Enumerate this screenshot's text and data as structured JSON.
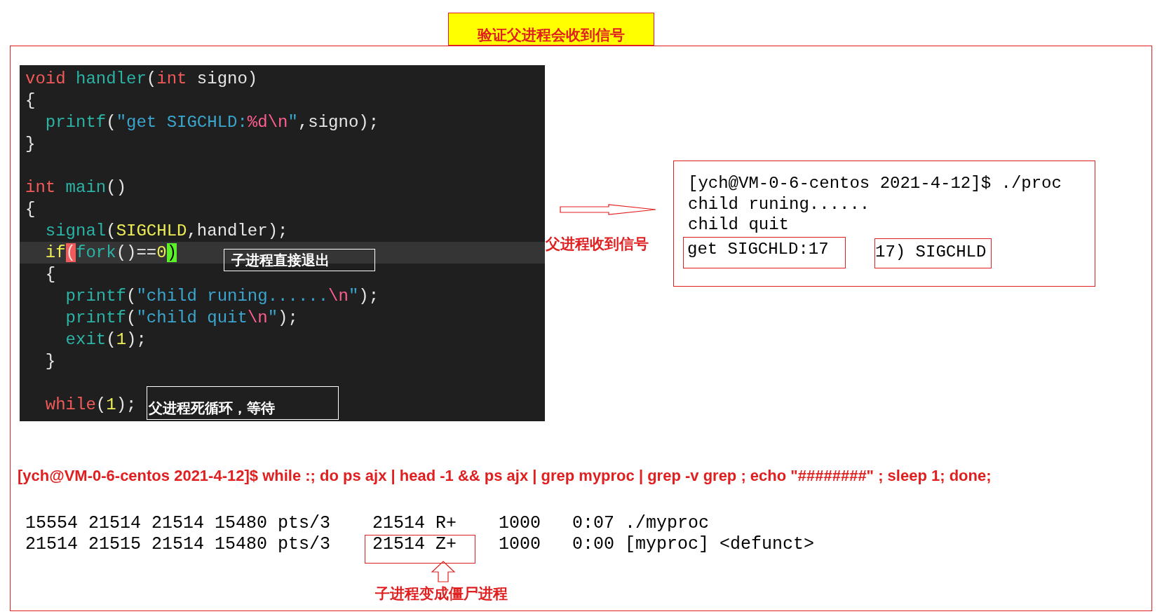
{
  "title": "验证父进程会收到信号",
  "code": {
    "lines": [
      {
        "current": false,
        "tokens": [
          {
            "kind": "kw",
            "text": "void"
          },
          {
            "kind": "fn",
            "text": " handler"
          },
          {
            "kind": "plain",
            "text": "("
          },
          {
            "kind": "kw",
            "text": "int"
          },
          {
            "kind": "plain",
            "text": " signo)"
          }
        ]
      },
      {
        "current": false,
        "tokens": [
          {
            "kind": "plain",
            "text": "{"
          }
        ]
      },
      {
        "current": false,
        "tokens": [
          {
            "kind": "fn",
            "text": "  printf"
          },
          {
            "kind": "plain",
            "text": "("
          },
          {
            "kind": "str",
            "text": "\"get SIGCHLD:"
          },
          {
            "kind": "esc",
            "text": "%d\\n"
          },
          {
            "kind": "str",
            "text": "\""
          },
          {
            "kind": "plain",
            "text": ",signo);"
          }
        ]
      },
      {
        "current": false,
        "tokens": [
          {
            "kind": "plain",
            "text": "}"
          }
        ]
      },
      {
        "current": false
      },
      {
        "current": false,
        "tokens": [
          {
            "kind": "kw",
            "text": "int"
          },
          {
            "kind": "fn",
            "text": " main"
          },
          {
            "kind": "plain",
            "text": "()"
          }
        ]
      },
      {
        "current": false,
        "tokens": [
          {
            "kind": "plain",
            "text": "{"
          }
        ]
      },
      {
        "current": false,
        "tokens": [
          {
            "kind": "fn",
            "text": "  signal"
          },
          {
            "kind": "plain",
            "text": "("
          },
          {
            "kind": "const",
            "text": "SIGCHLD"
          },
          {
            "kind": "plain",
            "text": ",handler);"
          }
        ]
      },
      {
        "current": true,
        "tokens": [
          {
            "kind": "const",
            "text": "  if"
          },
          {
            "kind": "match_open",
            "text": "("
          },
          {
            "kind": "fn",
            "text": "fork"
          },
          {
            "kind": "plain",
            "text": "()=="
          },
          {
            "kind": "const",
            "text": "0"
          },
          {
            "kind": "match_close",
            "text": ")"
          }
        ]
      },
      {
        "current": false,
        "tokens": [
          {
            "kind": "plain",
            "text": "  {"
          }
        ]
      },
      {
        "current": false,
        "tokens": [
          {
            "kind": "fn",
            "text": "    printf"
          },
          {
            "kind": "plain",
            "text": "("
          },
          {
            "kind": "str",
            "text": "\"child runing......"
          },
          {
            "kind": "esc",
            "text": "\\n"
          },
          {
            "kind": "str",
            "text": "\""
          },
          {
            "kind": "plain",
            "text": ");"
          }
        ]
      },
      {
        "current": false,
        "tokens": [
          {
            "kind": "fn",
            "text": "    printf"
          },
          {
            "kind": "plain",
            "text": "("
          },
          {
            "kind": "str",
            "text": "\"child quit"
          },
          {
            "kind": "esc",
            "text": "\\n"
          },
          {
            "kind": "str",
            "text": "\""
          },
          {
            "kind": "plain",
            "text": ");"
          }
        ]
      },
      {
        "current": false,
        "tokens": [
          {
            "kind": "fn",
            "text": "    exit"
          },
          {
            "kind": "plain",
            "text": "("
          },
          {
            "kind": "const",
            "text": "1"
          },
          {
            "kind": "plain",
            "text": ");"
          }
        ]
      },
      {
        "current": false,
        "tokens": [
          {
            "kind": "plain",
            "text": "  }"
          }
        ]
      },
      {
        "current": false
      },
      {
        "current": false,
        "tokens": [
          {
            "kind": "kw",
            "text": "  while"
          },
          {
            "kind": "plain",
            "text": "("
          },
          {
            "kind": "const",
            "text": "1"
          },
          {
            "kind": "plain",
            "text": ");"
          }
        ]
      }
    ]
  },
  "code_notes": [
    "子进程直接退出",
    "父进程死循环，等待"
  ],
  "signal_note": "父进程收到信号",
  "terminal": {
    "lines": [
      "[ych@VM-0-6-centos 2021-4-12]$ ./proc",
      "child runing......",
      "child quit"
    ],
    "results": [
      "get SIGCHLD:17",
      "17) SIGCHLD"
    ]
  },
  "command": "[ych@VM-0-6-centos 2021-4-12]$ while :; do ps ajx | head -1 && ps ajx | grep myproc | grep -v grep ; echo \"########\" ; sleep 1; done;",
  "ps_rows": [
    [
      "15554",
      "21514",
      "21514",
      "15480",
      "pts/3",
      "21514",
      "R+",
      "1000",
      "0:07",
      "./myproc"
    ],
    [
      "21514",
      "21515",
      "21514",
      "15480",
      "pts/3",
      "21514",
      "Z+",
      "1000",
      "0:00",
      "[myproc] <defunct>"
    ]
  ],
  "zombie_note": "子进程变成僵尸进程"
}
